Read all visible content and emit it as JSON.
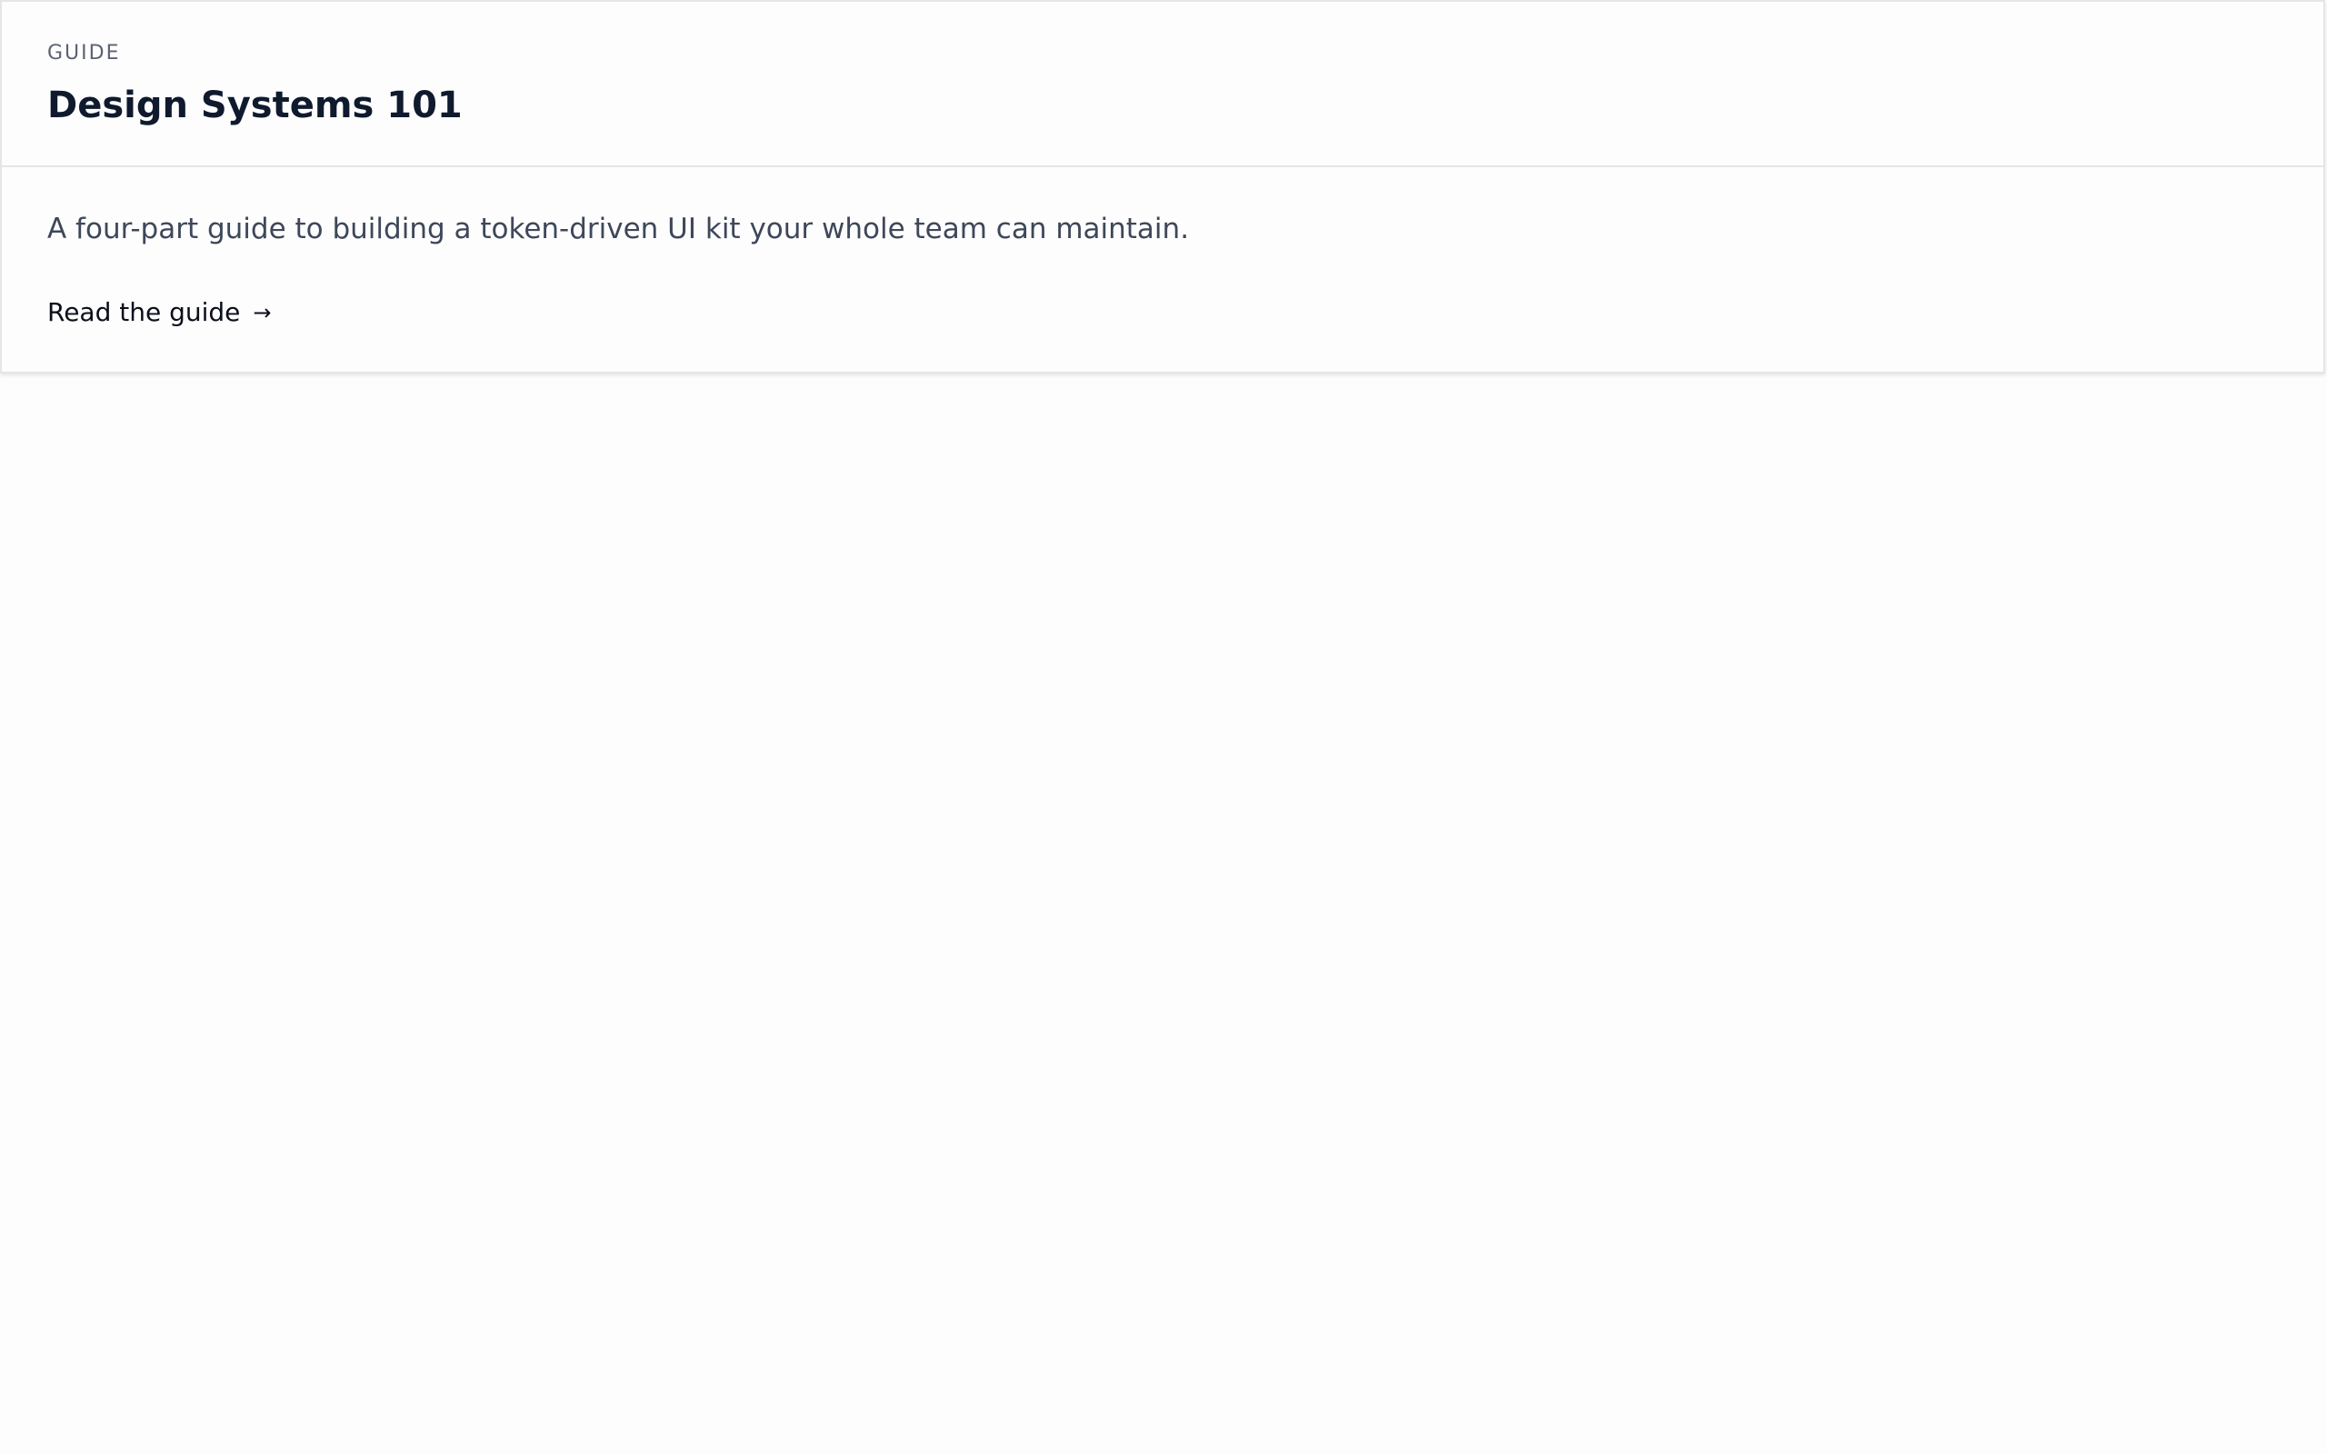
{
  "card": {
    "eyebrow": "GUIDE",
    "title": "Design Systems 101",
    "description": "A four-part guide to building a token-driven UI kit your whole team can maintain.",
    "cta_label": "Read the guide",
    "cta_arrow": "→"
  },
  "colors": {
    "background": "#fdfdfd",
    "border": "#e3e5e9",
    "eyebrow": "#5b6373",
    "title": "#0f1a2e",
    "description": "#3e475a",
    "link": "#0a0f1c"
  },
  "icons": {
    "cta_icon": "arrow-right-icon"
  }
}
